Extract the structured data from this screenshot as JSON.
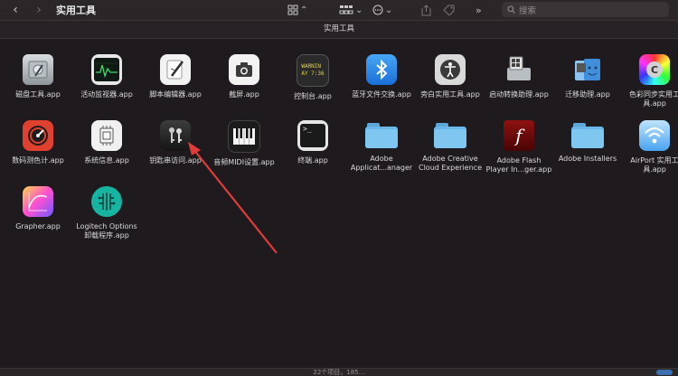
{
  "window": {
    "title": "实用工具",
    "tab_title": "实用工具",
    "search_placeholder": "搜索",
    "status_text": "22个项目，185…"
  },
  "toolbar": {
    "back_icon": "chevron-left-icon",
    "forward_icon": "chevron-right-icon",
    "view_icon": "grid-view-icon",
    "group_icon": "group-by-icon",
    "action_icon": "ellipsis-circle-icon",
    "share_icon": "share-icon",
    "tag_icon": "tag-icon",
    "more_icon": "chevron-double-right-icon"
  },
  "apps": [
    {
      "label": "磁盘工具.app",
      "icon": "disk-utility-icon"
    },
    {
      "label": "活动监视器.app",
      "icon": "activity-monitor-icon"
    },
    {
      "label": "脚本编辑器.app",
      "icon": "script-editor-icon"
    },
    {
      "label": "截屏.app",
      "icon": "screenshot-icon"
    },
    {
      "label": "控制台.app",
      "icon": "console-icon"
    },
    {
      "label": "蓝牙文件交换.app",
      "icon": "bluetooth-icon"
    },
    {
      "label": "旁白实用工具.app",
      "icon": "voiceover-icon"
    },
    {
      "label": "启动转换助理.app",
      "icon": "boot-camp-icon"
    },
    {
      "label": "迁移助理.app",
      "icon": "migration-assistant-icon"
    },
    {
      "label": "色彩同步实用工\n具.app",
      "icon": "colorsync-icon"
    },
    {
      "label": "数码测色计.app",
      "icon": "digital-color-meter-icon"
    },
    {
      "label": "系统信息.app",
      "icon": "system-information-icon"
    },
    {
      "label": "钥匙串访问.app",
      "icon": "keychain-access-icon"
    },
    {
      "label": "音频MIDI设置.app",
      "icon": "audio-midi-icon"
    },
    {
      "label": "终端.app",
      "icon": "terminal-icon"
    },
    {
      "label": "Adobe\nApplicat...anager",
      "icon": "folder-icon"
    },
    {
      "label": "Adobe Creative\nCloud Experience",
      "icon": "folder-icon"
    },
    {
      "label": "Adobe Flash\nPlayer In...ger.app",
      "icon": "flash-icon"
    },
    {
      "label": "Adobe Installers",
      "icon": "folder-icon"
    },
    {
      "label": "AirPort 实用工\n具.app",
      "icon": "airport-icon"
    },
    {
      "label": "Grapher.app",
      "icon": "grapher-icon"
    },
    {
      "label": "Logitech Options\n卸载程序.app",
      "icon": "logitech-icon"
    }
  ],
  "console_icon_text": [
    "WARNIN",
    "AY 7:36"
  ],
  "annotation": {
    "icon": "red-arrow-annotation",
    "color": "#e23b3b"
  }
}
